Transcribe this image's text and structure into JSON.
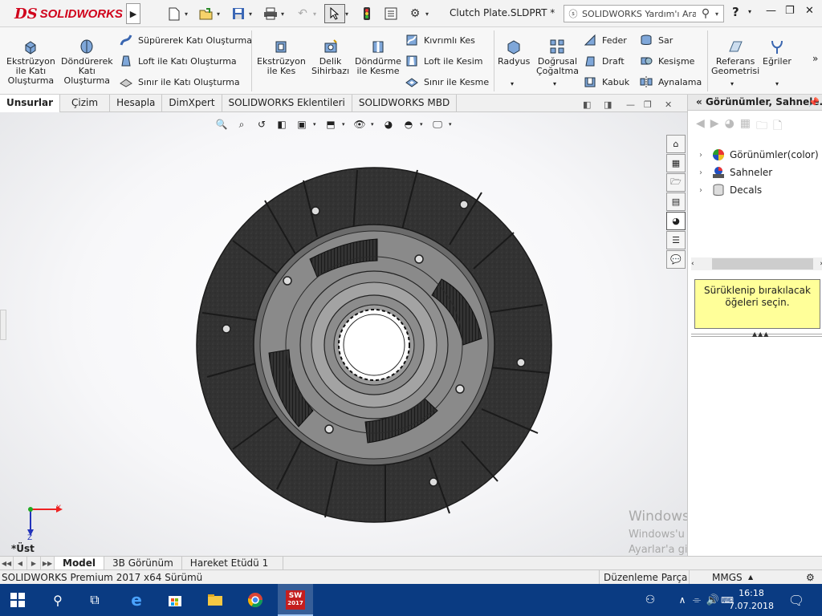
{
  "app": {
    "logo_ds": "DS",
    "logo_text": "SOLIDWORKS",
    "document_title": "Clutch Plate.SLDPRT *",
    "search_placeholder": "SOLIDWORKS Yardım'ı Ara",
    "help_label": "?"
  },
  "ribbon": {
    "features_group1": [
      {
        "label": "Ekstrüzyon\nile Katı\nOluşturma"
      },
      {
        "label": "Döndürerek\nKatı\nOluşturma"
      }
    ],
    "features_list1": [
      "Süpürerek Katı Oluşturma",
      "Loft ile Katı Oluşturma",
      "Sınır ile Katı Oluşturma"
    ],
    "features_group2": [
      {
        "label": "Ekstrüzyon\nile Kes"
      },
      {
        "label": "Delik\nSihirbazı"
      },
      {
        "label": "Döndürme\nile Kesme"
      }
    ],
    "features_list2": [
      "Kıvrımlı Kes",
      "Loft ile Kesim",
      "Sınır ile Kesme"
    ],
    "features_group3": [
      {
        "label": "Radyus"
      },
      {
        "label": "Doğrusal\nÇoğaltma"
      }
    ],
    "features_list3": [
      "Feder",
      "Draft",
      "Kabuk"
    ],
    "features_list4": [
      "Sar",
      "Kesişme",
      "Aynalama"
    ],
    "features_group4": [
      {
        "label": "Referans\nGeometrisi"
      },
      {
        "label": "Eğriler"
      }
    ]
  },
  "tabs": [
    "Unsurlar",
    "Çizim",
    "Hesapla",
    "DimXpert",
    "SOLIDWORKS Eklentileri",
    "SOLIDWORKS MBD"
  ],
  "viewport": {
    "view_label": "*Üst",
    "triad_x": "X",
    "triad_y": "Y",
    "triad_z": "Z"
  },
  "watermark": {
    "title": "Windows'u Etkinleştir",
    "line1": "Windows'u etkinleştirmek için",
    "line2": "Ayarlar'a gidin."
  },
  "bottom_tabs": [
    "Model",
    "3B Görünüm",
    "Hareket Etüdü 1"
  ],
  "status": {
    "version": "SOLIDWORKS Premium 2017 x64 Sürümü",
    "mode": "Düzenleme Parça",
    "units": "MMGS"
  },
  "task_pane": {
    "title": "Görünümler, Sahnele...",
    "tree": [
      "Görünümler(color)",
      "Sahneler",
      "Decals"
    ],
    "drop_hint": "Sürüklenip bırakılacak öğeleri seçin."
  },
  "taskbar": {
    "time": "16:18",
    "date": "7.07.2018",
    "sw_badge": "2017"
  }
}
